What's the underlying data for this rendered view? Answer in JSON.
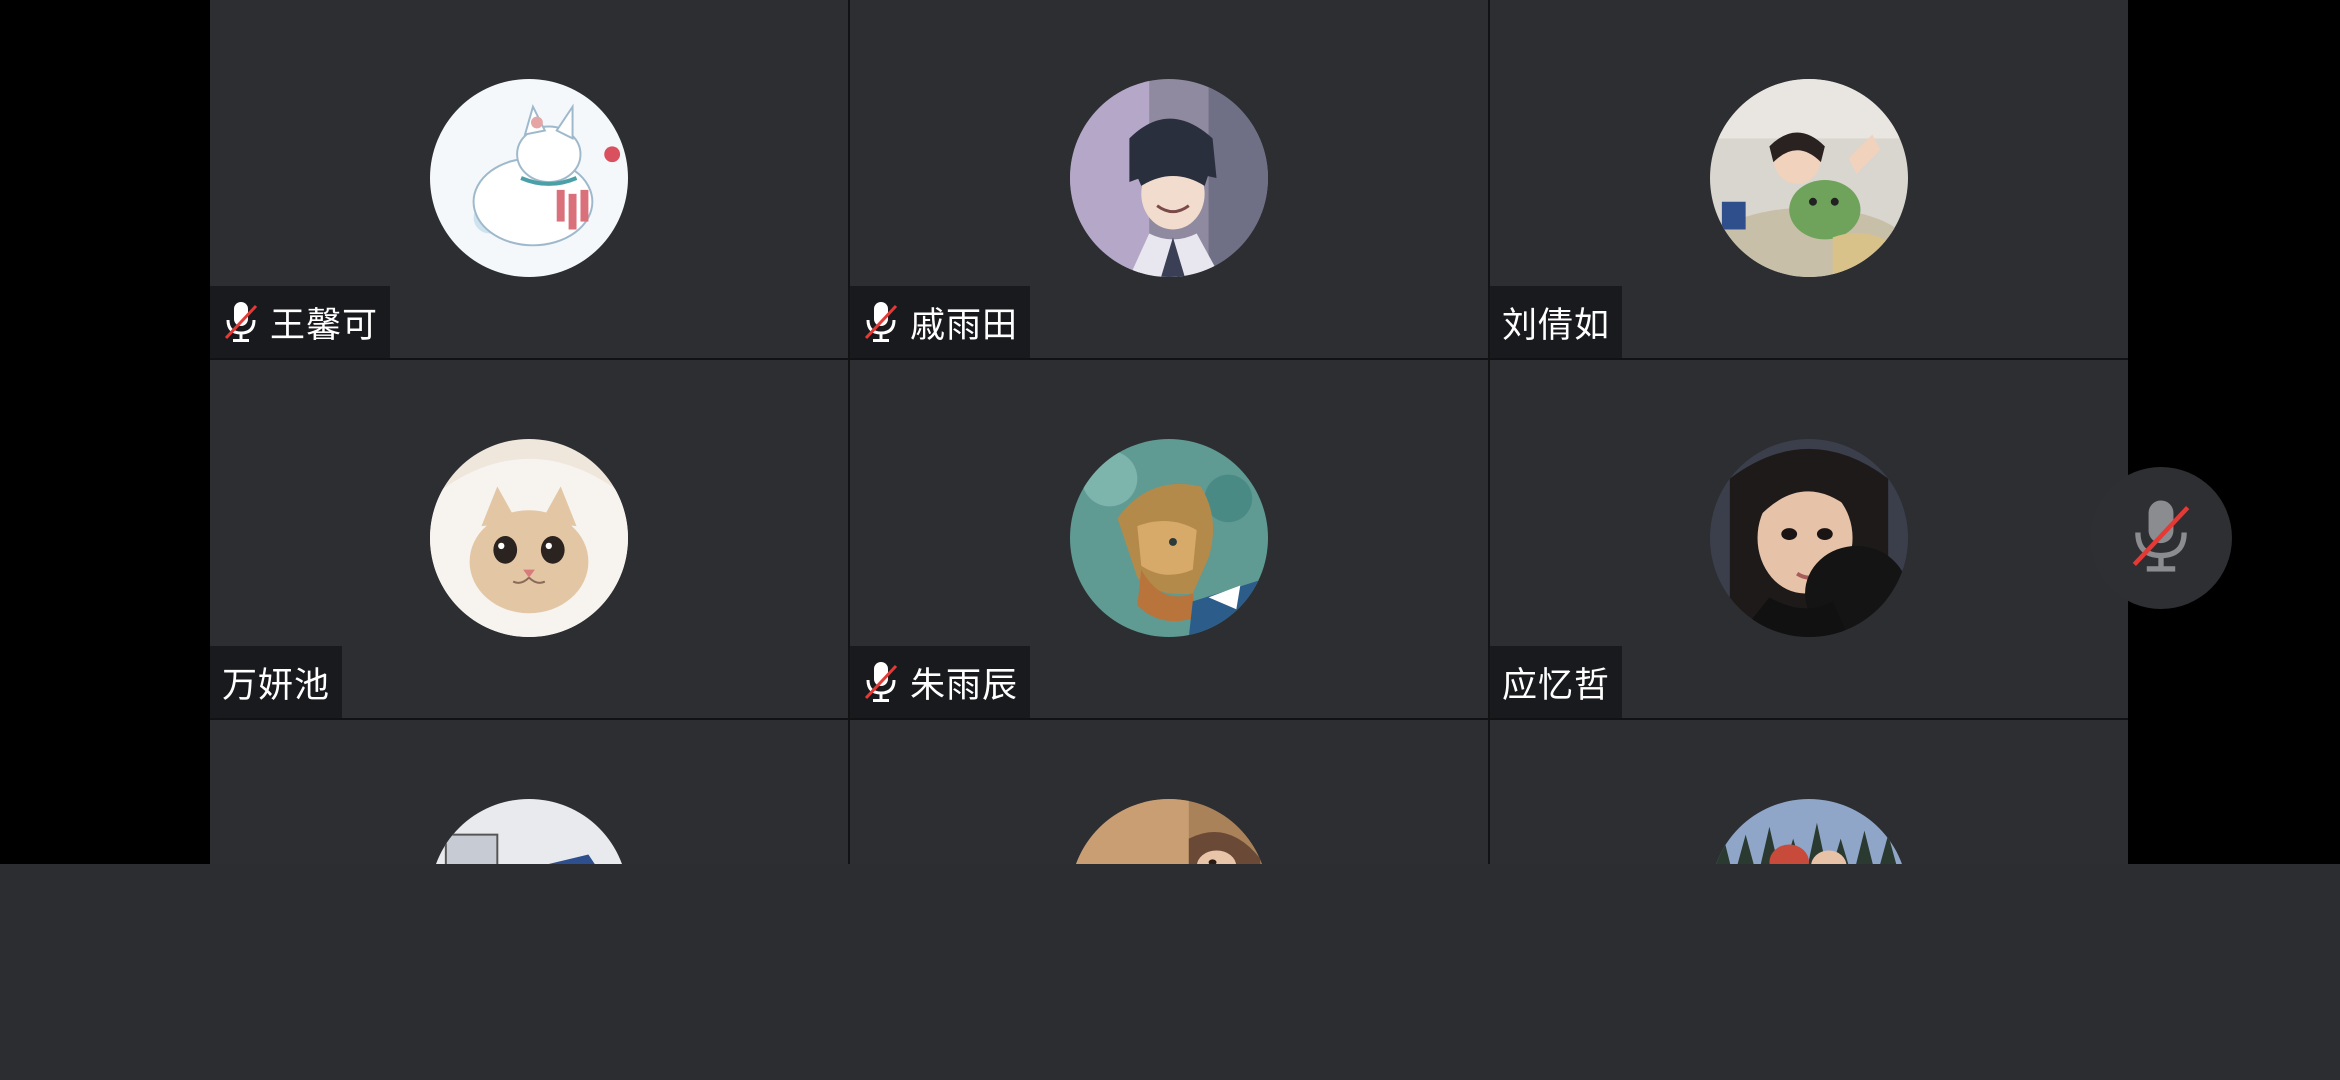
{
  "participants": [
    {
      "name": "王馨可",
      "muted": true,
      "avatar": "white-fox-illustration"
    },
    {
      "name": "戚雨田",
      "muted": true,
      "avatar": "anime-boy-illustration"
    },
    {
      "name": "刘倩如",
      "muted": false,
      "avatar": "girl-with-plush-toy-photo"
    },
    {
      "name": "万妍池",
      "muted": false,
      "avatar": "cat-in-hood-photo"
    },
    {
      "name": "朱雨辰",
      "muted": true,
      "avatar": "van-gogh-portrait-painting"
    },
    {
      "name": "应忆哲",
      "muted": false,
      "avatar": "girl-selfie-photo"
    },
    {
      "name": "",
      "muted": false,
      "avatar": "boy-lying-illustration"
    },
    {
      "name": "",
      "muted": false,
      "avatar": "warm-toned-photo"
    },
    {
      "name": "",
      "muted": false,
      "avatar": "forest-sky-photo"
    }
  ],
  "local_mic": {
    "muted": true,
    "icon": "mic-muted-icon"
  },
  "colors": {
    "tile_bg": "#2c2e32",
    "name_tag_bg": "#18191c",
    "muted_slash": "#e53935",
    "bottom_bar_bg": "#2b2d31"
  }
}
